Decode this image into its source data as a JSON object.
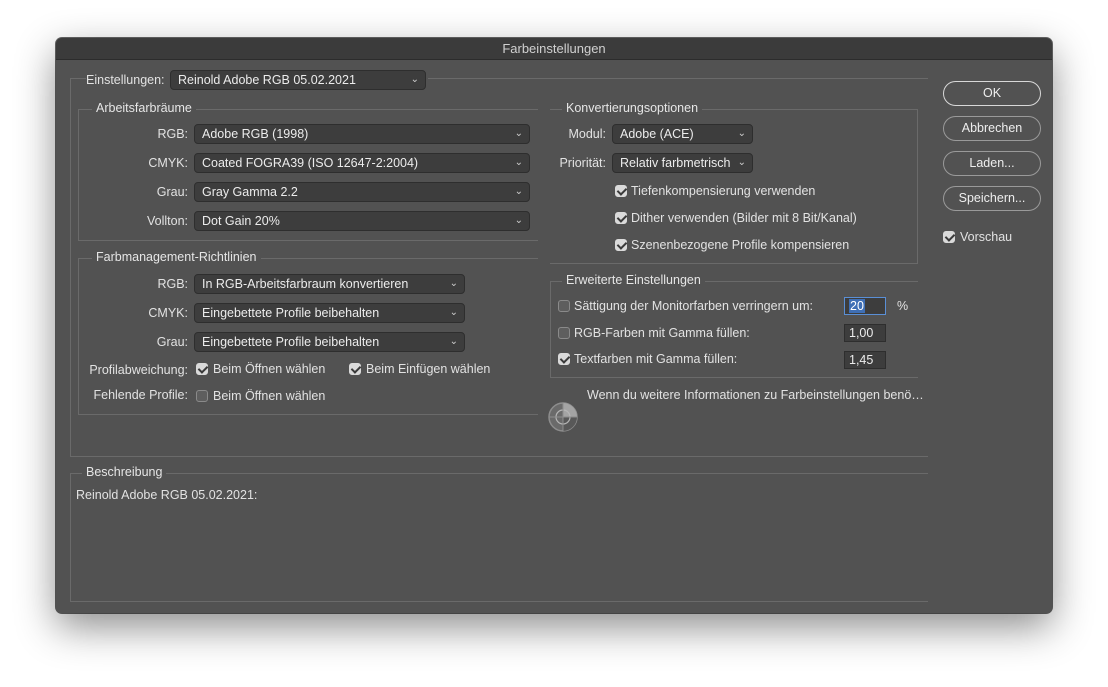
{
  "title": "Farbeinstellungen",
  "settings": {
    "label": "Einstellungen:",
    "value": "Reinold Adobe RGB 05.02.2021"
  },
  "working_spaces": {
    "title": "Arbeitsfarbräume",
    "rows": [
      {
        "label": "RGB:",
        "value": "Adobe RGB (1998)"
      },
      {
        "label": "CMYK:",
        "value": "Coated FOGRA39 (ISO 12647-2:2004)"
      },
      {
        "label": "Grau:",
        "value": "Gray Gamma 2.2"
      },
      {
        "label": "Vollton:",
        "value": "Dot Gain 20%"
      }
    ]
  },
  "policies": {
    "title": "Farbmanagement-Richtlinien",
    "rows": [
      {
        "label": "RGB:",
        "value": "In RGB-Arbeitsfarbraum konvertieren"
      },
      {
        "label": "CMYK:",
        "value": "Eingebettete Profile beibehalten"
      },
      {
        "label": "Grau:",
        "value": "Eingebettete Profile beibehalten"
      }
    ],
    "mismatch_label": "Profilabweichung:",
    "mismatch_open": {
      "label": "Beim Öffnen wählen",
      "checked": true
    },
    "mismatch_paste": {
      "label": "Beim Einfügen wählen",
      "checked": true
    },
    "missing_label": "Fehlende Profile:",
    "missing_open": {
      "label": "Beim Öffnen wählen",
      "checked": false
    }
  },
  "conversion": {
    "title": "Konvertierungsoptionen",
    "engine_label": "Modul:",
    "engine_value": "Adobe (ACE)",
    "intent_label": "Priorität:",
    "intent_value": "Relativ farbmetrisch",
    "options": [
      {
        "label": "Tiefenkompensierung verwenden",
        "checked": true
      },
      {
        "label": "Dither verwenden (Bilder mit 8 Bit/Kanal)",
        "checked": true
      },
      {
        "label": "Szenenbezogene Profile kompensieren",
        "checked": true
      }
    ]
  },
  "advanced": {
    "title": "Erweiterte Einstellungen",
    "rows": [
      {
        "label": "Sättigung der Monitorfarben verringern um:",
        "value": "20",
        "unit": "%",
        "checked": false
      },
      {
        "label": "RGB-Farben mit Gamma füllen:",
        "value": "1,00",
        "unit": "",
        "checked": false
      },
      {
        "label": "Textfarben mit Gamma füllen:",
        "value": "1,45",
        "unit": "",
        "checked": true
      }
    ]
  },
  "info_text": "Wenn du weitere Informationen zu Farbeinstellungen benö…",
  "description": {
    "title": "Beschreibung",
    "text": "Reinold Adobe RGB 05.02.2021:"
  },
  "buttons": {
    "ok": "OK",
    "cancel": "Abbrechen",
    "load": "Laden...",
    "save": "Speichern..."
  },
  "preview": {
    "label": "Vorschau",
    "checked": true
  },
  "icons": {
    "info": "color-wheel-icon",
    "dropdown": "chevron-down-icon"
  },
  "colors": {
    "window_bg": "#525252",
    "field_bg": "#3d3d3d",
    "selection": "#3f6fb5"
  }
}
